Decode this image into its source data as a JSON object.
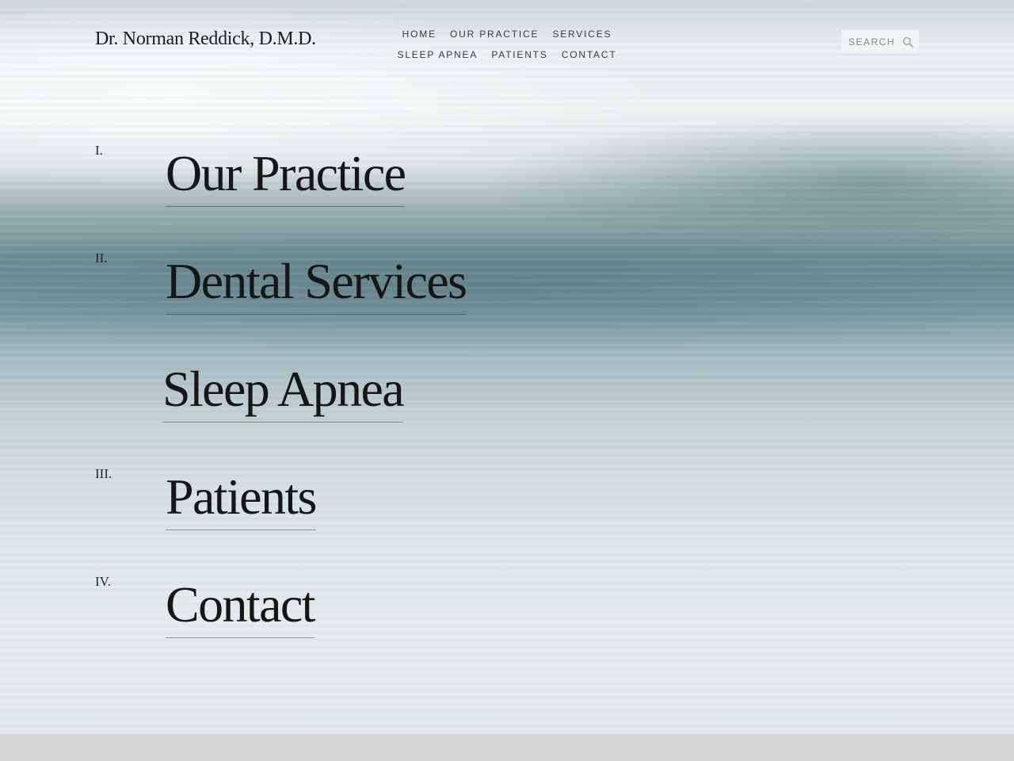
{
  "site": {
    "title": "Dr. Norman Reddick, D.M.D."
  },
  "nav": {
    "row1": [
      "HOME",
      "OUR PRACTICE",
      "SERVICES"
    ],
    "row2": [
      "SLEEP APNEA",
      "PATIENTS",
      "CONTACT"
    ]
  },
  "search": {
    "placeholder": "SEARCH",
    "icon": "search-icon"
  },
  "menu": [
    {
      "numeral": "I.",
      "label": "Our Practice"
    },
    {
      "numeral": "II.",
      "label": "Dental Services"
    },
    {
      "numeral": "",
      "label": "Sleep Apnea"
    },
    {
      "numeral": "III.",
      "label": "Patients"
    },
    {
      "numeral": "IV.",
      "label": "Contact"
    }
  ],
  "colors": {
    "text": "#161616",
    "footer_band": "#d6d6d6",
    "search_bg": "#f2f4f5"
  }
}
